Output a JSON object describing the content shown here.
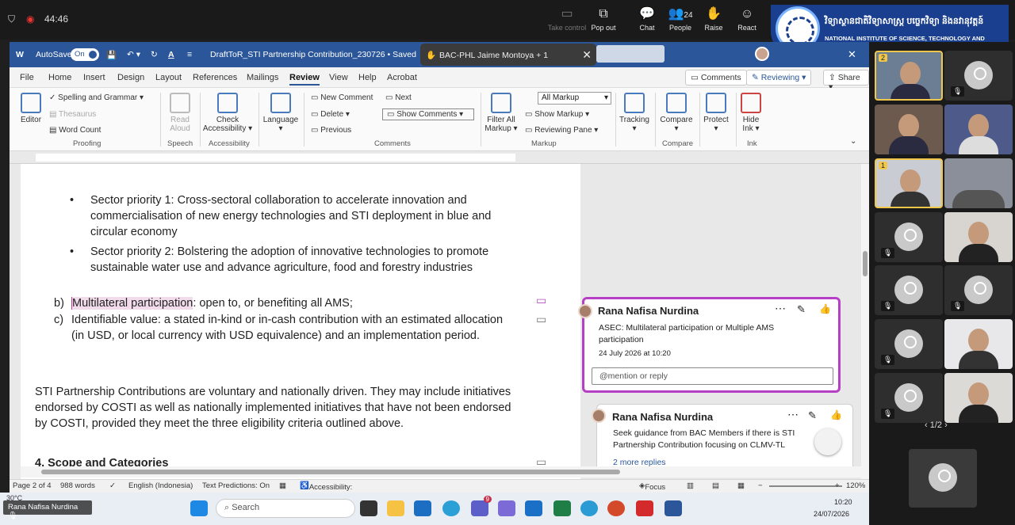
{
  "zoom": {
    "time": "44:46",
    "take_control": "Take control",
    "pop_out": "Pop out",
    "chat": "Chat",
    "people": "People",
    "people_count": "24",
    "raise": "Raise",
    "react": "React"
  },
  "banner": {
    "khmer": "វិទ្យាស្ថានជាតិវិទ្យាសាស្ត្រ បច្ចេកវិទ្យា និងនវានុវត្តន៍",
    "english": "NATIONAL INSTITUTE OF SCIENCE, TECHNOLOGY AND INNOVATION"
  },
  "word": {
    "autosave_label": "AutoSave",
    "autosave_state": "On",
    "doc_title": "DraftToR_STI Partnership Contribution_230726 • Saved",
    "meeting_chip": "BAC-PHL Jaime Montoya + 1",
    "menu": [
      "File",
      "Home",
      "Insert",
      "Design",
      "Layout",
      "References",
      "Mailings",
      "Review",
      "View",
      "Help",
      "Acrobat"
    ],
    "active_menu": "Review",
    "comments_btn": "Comments",
    "reviewing_btn": "Reviewing",
    "share_btn": "Share",
    "ribbon": {
      "editor": "Editor",
      "spelling": "Spelling and Grammar",
      "thesaurus": "Thesaurus",
      "word_count": "Word Count",
      "proofing": "Proofing",
      "read_aloud_1": "Read",
      "read_aloud_2": "Aloud",
      "speech": "Speech",
      "check_1": "Check",
      "check_2": "Accessibility",
      "accessibility": "Accessibility",
      "language": "Language",
      "new_comment": "New Comment",
      "delete": "Delete",
      "previous": "Previous",
      "next": "Next",
      "show_comments": "Show Comments",
      "comments": "Comments",
      "filter_1": "Filter All",
      "filter_2": "Markup",
      "all_markup": "All Markup",
      "show_markup": "Show Markup",
      "reviewing_pane": "Reviewing Pane",
      "markup": "Markup",
      "tracking": "Tracking",
      "compare_btn": "Compare",
      "compare": "Compare",
      "protect": "Protect",
      "hide_1": "Hide",
      "hide_2": "Ink",
      "ink": "Ink"
    },
    "doc": {
      "bullet1": "Sector priority 1: Cross-sectoral collaboration to accelerate innovation and commercialisation of new energy technologies and STI deployment in blue and circular economy",
      "bullet2": "Sector priority 2: Bolstering the adoption of innovative technologies to promote sustainable water use and advance agriculture, food and forestry industries",
      "b_label": "b)",
      "b_highlight": "Multilateral participation",
      "b_rest": ": open to, or benefiting all AMS;",
      "c_label": "c)",
      "c_text": "Identifiable value: a stated in-kind or in-cash contribution with an estimated allocation (in USD, or local currency with USD equivalence) and an implementation period.",
      "para": "STI Partnership Contributions are voluntary and nationally driven. They may include initiatives endorsed by COSTI as well as nationally implemented initiatives that have not been endorsed by COSTI, provided they meet the three eligibility criteria outlined above.",
      "heading": "4. Scope and Categories"
    },
    "comment1": {
      "author": "Rana Nafisa Nurdina",
      "text": "ASEC: Multilateral participation or Multiple AMS participation",
      "date": "24 July 2026 at 10:20",
      "reply_placeholder": "@mention or reply"
    },
    "comment2": {
      "author": "Rana Nafisa Nurdina",
      "text": "Seek guidance from BAC Members if there is STI Partnership Contribution focusing on CLMV-TL",
      "more": "2 more replies"
    },
    "status": {
      "page": "Page 2 of 4",
      "words": "988 words",
      "language": "English (Indonesia)",
      "predictions": "Text Predictions: On",
      "accessibility": "Accessibility: Investigate",
      "focus": "Focus",
      "zoom": "120%"
    }
  },
  "taskbar": {
    "search": "Search",
    "temp": "30°C",
    "time": "10:20",
    "date": "24/07/2026",
    "badge": "9"
  },
  "participants": {
    "page": "1/2",
    "name_tag": "Rana Nafisa Nurdina",
    "hand2": "2",
    "hand1": "1"
  }
}
